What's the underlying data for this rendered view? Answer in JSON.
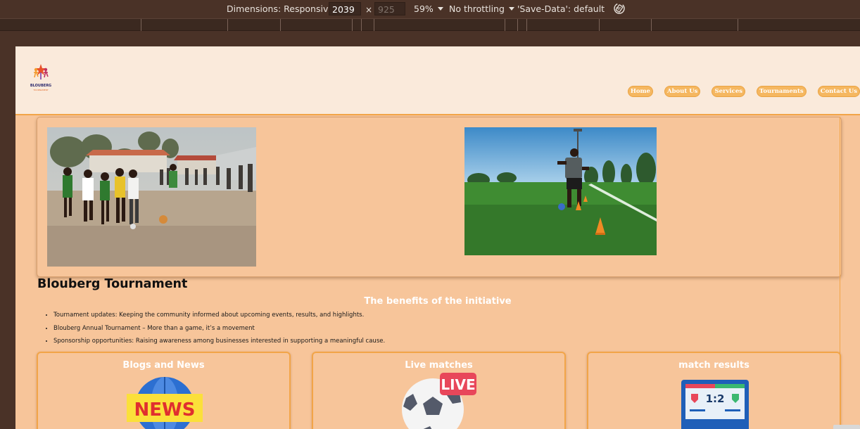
{
  "devtools": {
    "dimensions_label": "Dimensions: Responsive",
    "width_value": "2039",
    "times": "×",
    "height_value": "925",
    "zoom": "59%",
    "throttling": "No throttling",
    "save_data": "'Save-Data': default"
  },
  "site": {
    "logo": {
      "brand": "BLOUBERG",
      "tagline": "TOURNAMENT"
    },
    "nav": [
      "Home",
      "About Us",
      "Services",
      "Tournaments",
      "Contact Us"
    ],
    "title": "Blouberg Tournament",
    "subtitle": "The benefits of the initiative",
    "benefits": [
      "Tournament updates: Keeping the community informed about upcoming events, results, and highlights.",
      "Blouberg Annual Tournament – More than a game, it’s a movement",
      "Sponsorship opportunities: Raising awareness among businesses interested in supporting a meaningful cause."
    ],
    "cards": [
      {
        "title": "Blogs and News",
        "icon": "news-globe-icon",
        "badge": "NEWS"
      },
      {
        "title": "Live matches",
        "icon": "live-soccer-ball-icon",
        "badge": "LIVE"
      },
      {
        "title": "match results",
        "icon": "scoreboard-icon",
        "badge": "1:2"
      }
    ]
  },
  "colors": {
    "page_bg": "#f7c59a",
    "header_bg": "#faeadb",
    "accent": "#f2a548",
    "devtools_bg": "#4a3227"
  }
}
